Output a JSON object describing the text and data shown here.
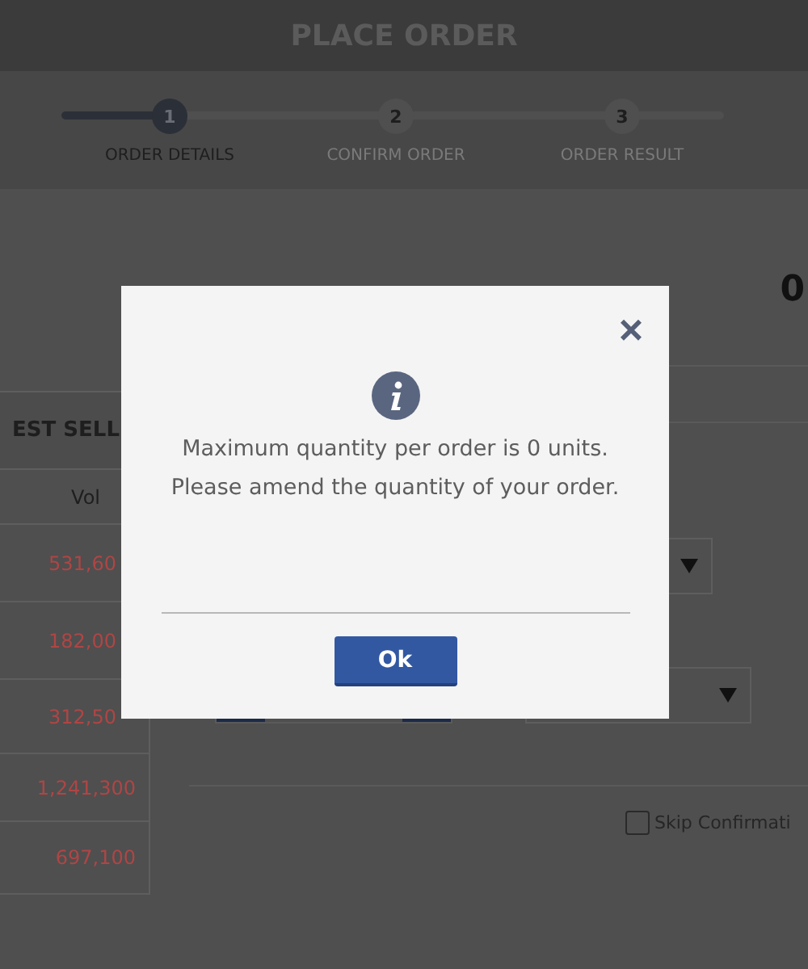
{
  "header": {
    "title": "PLACE ORDER"
  },
  "steps": [
    {
      "number": "1",
      "label": "ORDER DETAILS",
      "selected": true
    },
    {
      "number": "2",
      "label": "CONFIRM ORDER",
      "selected": false
    },
    {
      "number": "3",
      "label": "ORDER RESULT",
      "selected": false
    }
  ],
  "summary": {
    "value": "0"
  },
  "table": {
    "title": "EST SELL",
    "column": "Vol",
    "rows": [
      "531,60",
      "182,00",
      "312,50",
      "1,241,300",
      "697,100"
    ]
  },
  "options": {
    "skip_confirmation": {
      "label": "Skip Confirmati",
      "checked": false
    }
  },
  "dialog": {
    "close": "×",
    "message": "Maximum quantity per order is 0 units. Please amend the quantity of your order.",
    "button": "Ok"
  }
}
